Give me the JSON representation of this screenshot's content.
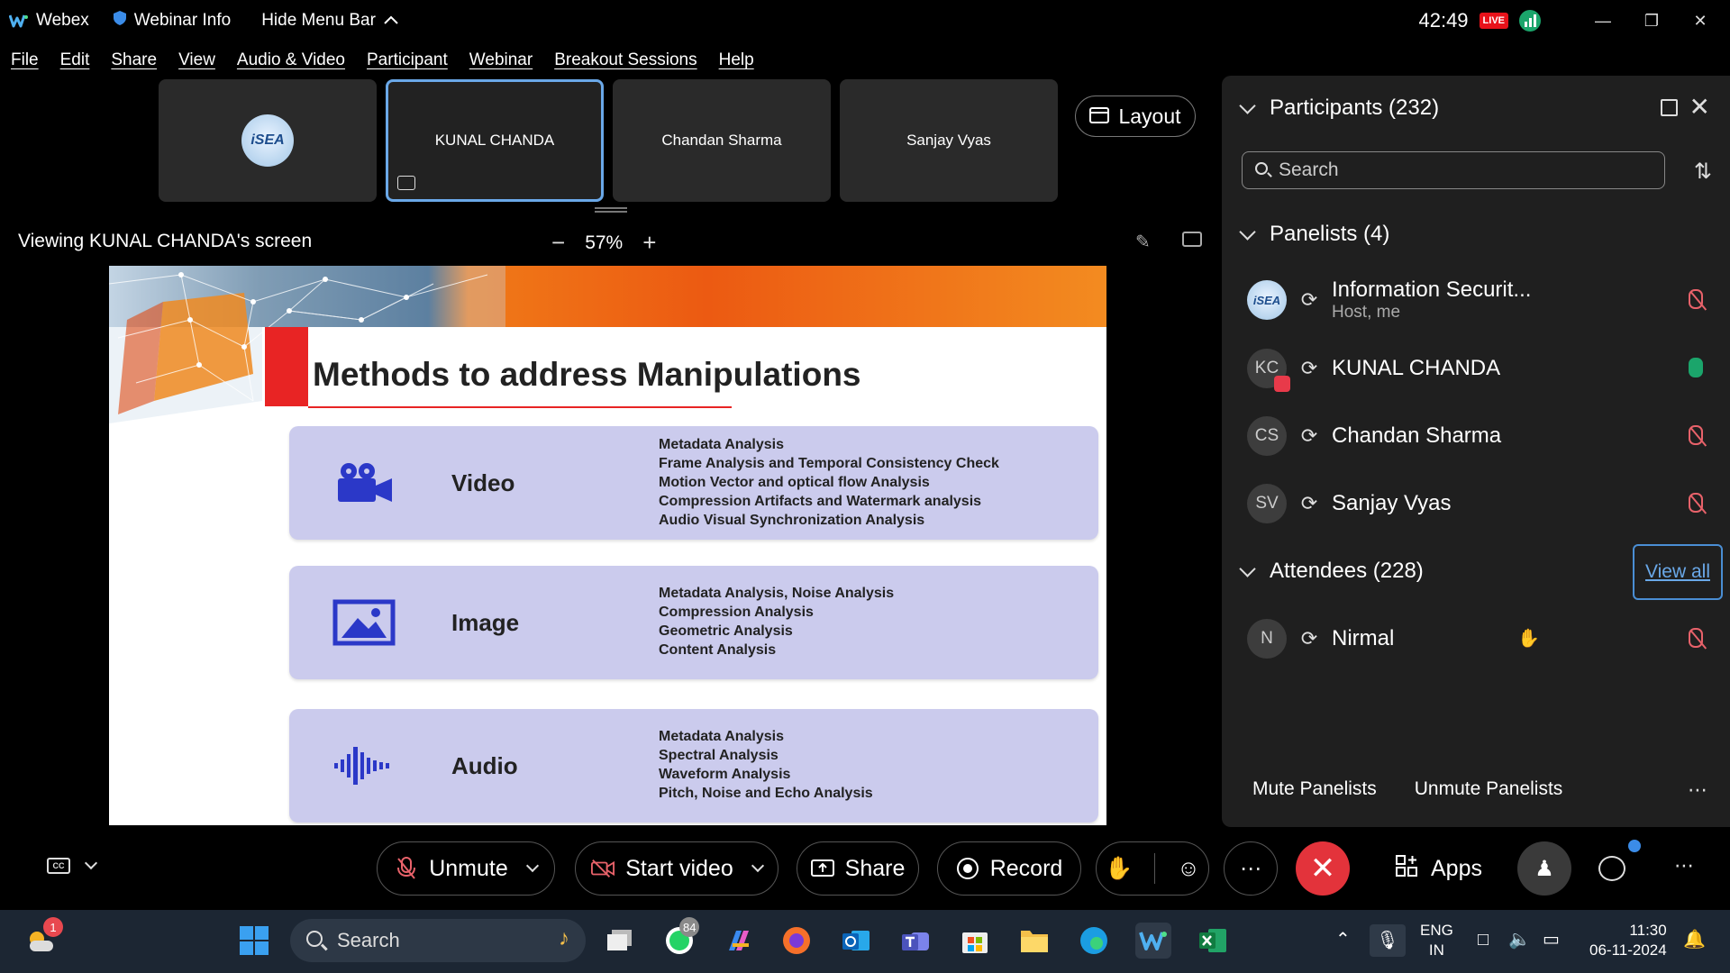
{
  "titlebar": {
    "app_name": "Webex",
    "webinar_info": "Webinar Info",
    "hide_menu": "Hide Menu Bar",
    "timer": "42:49",
    "live_badge": "LIVE"
  },
  "menu": [
    "File",
    "Edit",
    "Share",
    "View",
    "Audio & Video",
    "Participant",
    "Webinar",
    "Breakout Sessions",
    "Help"
  ],
  "thumbnails": [
    {
      "name": "",
      "logo": "iSEA"
    },
    {
      "name": "KUNAL CHANDA"
    },
    {
      "name": "Chandan Sharma"
    },
    {
      "name": "Sanjay Vyas"
    }
  ],
  "layout_label": "Layout",
  "viewing": {
    "text": "Viewing KUNAL CHANDA's screen",
    "zoom": "57%"
  },
  "slide": {
    "title": "Methods to address Manipulations",
    "methods": [
      {
        "label": "Video",
        "icon": "video-camera-icon",
        "items": [
          "Metadata Analysis",
          "Frame Analysis and Temporal Consistency Check",
          "Motion Vector and optical flow Analysis",
          "Compression Artifacts and Watermark analysis",
          "Audio Visual Synchronization Analysis"
        ]
      },
      {
        "label": "Image",
        "icon": "image-icon",
        "items": [
          "Metadata Analysis, Noise Analysis",
          "Compression Analysis",
          "Geometric Analysis",
          "Content Analysis"
        ]
      },
      {
        "label": "Audio",
        "icon": "audio-waveform-icon",
        "items": [
          "Metadata Analysis",
          "Spectral Analysis",
          "Waveform Analysis",
          "Pitch, Noise and Echo Analysis"
        ]
      }
    ]
  },
  "participants": {
    "title": "Participants (232)",
    "search_placeholder": "Search",
    "panelists_title": "Panelists (4)",
    "panelists": [
      {
        "initials": "iSEA",
        "name": "Information Securit...",
        "sub": "Host, me",
        "mic": "muted"
      },
      {
        "initials": "KC",
        "name": "KUNAL CHANDA",
        "sub": "",
        "mic": "on"
      },
      {
        "initials": "CS",
        "name": "Chandan Sharma",
        "sub": "",
        "mic": "muted"
      },
      {
        "initials": "SV",
        "name": "Sanjay Vyas",
        "sub": "",
        "mic": "muted"
      }
    ],
    "attendees_title": "Attendees (228)",
    "view_all": "View all",
    "attendees": [
      {
        "initials": "N",
        "name": "Nirmal",
        "mic": "muted"
      }
    ],
    "mute_panelists": "Mute Panelists",
    "unmute_panelists": "Unmute Panelists"
  },
  "controls": {
    "unmute": "Unmute",
    "start_video": "Start video",
    "share": "Share",
    "record": "Record",
    "apps": "Apps",
    "cc": "CC"
  },
  "taskbar": {
    "search_placeholder": "Search",
    "weather_badge": "1",
    "whatsapp_badge": "84",
    "lang_line1": "ENG",
    "lang_line2": "IN",
    "time": "11:30",
    "date": "06-11-2024"
  },
  "colors": {
    "end_call": "#e3333b",
    "live": "#e8121a",
    "accent": "#4a8ed4",
    "slide_card": "#cbcbed",
    "slide_red": "#e82424"
  }
}
